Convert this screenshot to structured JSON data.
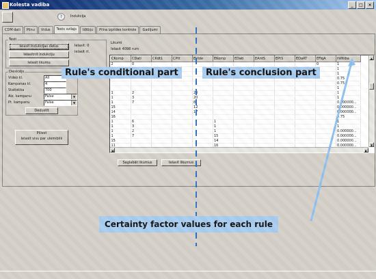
{
  "window": {
    "title": "Kolesta vadiba"
  },
  "toolbar": {
    "icon_glyph": "?",
    "label": "Indukcija"
  },
  "tabs": [
    {
      "label": "CDM dati"
    },
    {
      "label": "Pilnu"
    },
    {
      "label": "Vidus"
    },
    {
      "label": "Tests svilajs"
    },
    {
      "label": "Iđilbju"
    },
    {
      "label": "Pilna izpildes kontrole"
    },
    {
      "label": "Gadijumi"
    }
  ],
  "left_panel": {
    "top_group_caption": "Testi",
    "btn_primary": "Ielasit Indukcijas datus",
    "btn_second": "Ielasitnit indukciju",
    "btn_third": "Ielasit likumu",
    "side_labels": [
      "Ielasit: 0",
      "Ielasit rt."
    ],
    "settings_caption": "Dieslcējs",
    "fields": [
      {
        "label": "Video kl.",
        "value": "All"
      },
      {
        "label": "Kampanas kl.",
        "value": "4"
      },
      {
        "label": "Statistika",
        "value": "700"
      },
      {
        "label": "Aiz. kampanu",
        "value": "False"
      },
      {
        "label": "Pt. kampanu",
        "value": "False"
      }
    ],
    "btn_deduce": "Dedustīt",
    "btn_apply": "Piliest",
    "btn_apply_sub": "Ielasit visu par ulemiblik"
  },
  "grid": {
    "caption": "Likumi",
    "count_label": "Ielasit 4098 rum",
    "columns": [
      "CKomp",
      "CDati",
      "CKdt1",
      "CPtt",
      "EVide",
      "EKomp",
      "EDati",
      "EAntS",
      "EPtS",
      "EDaRT",
      "EFiqA",
      "tWitiba"
    ],
    "rows": [
      [
        "2",
        "0",
        "",
        "",
        "",
        "",
        "",
        "",
        "",
        "",
        "0",
        "1"
      ],
      [
        "",
        "",
        "",
        "",
        "",
        "",
        "",
        "",
        "",
        "",
        "",
        "1"
      ],
      [
        "",
        "",
        "",
        "",
        "",
        "",
        "",
        "",
        "",
        "",
        "",
        "1"
      ],
      [
        "",
        "",
        "",
        "",
        "",
        "",
        "",
        "",
        "",
        "",
        "",
        "0.75"
      ],
      [
        "",
        "",
        "",
        "",
        "",
        "",
        "",
        "",
        "",
        "",
        "",
        "0.75"
      ],
      [
        "",
        "",
        "",
        "",
        "",
        "",
        "",
        "",
        "",
        "",
        "",
        "1"
      ],
      [
        "1",
        "2",
        "",
        "",
        "20",
        "",
        "",
        "",
        "",
        "",
        "",
        "1"
      ],
      [
        "1",
        "3",
        "",
        "",
        "20",
        "",
        "",
        "",
        "",
        "",
        "",
        "1"
      ],
      [
        "1",
        "7",
        "",
        "",
        "8",
        "",
        "",
        "",
        "",
        "",
        "",
        "0.000000..."
      ],
      [
        "15",
        "",
        "",
        "",
        "12",
        "",
        "",
        "",
        "",
        "",
        "",
        "0.000000..."
      ],
      [
        "14",
        "",
        "",
        "",
        "17",
        "",
        "",
        "",
        "",
        "",
        "",
        "0.000000..."
      ],
      [
        "16",
        "",
        "",
        "",
        "",
        "",
        "",
        "",
        "",
        "",
        "",
        "0.75"
      ],
      [
        "1",
        "6",
        "",
        "",
        "",
        "1",
        "",
        "",
        "",
        "",
        "",
        "1"
      ],
      [
        "1",
        "3",
        "",
        "",
        "",
        "1",
        "",
        "",
        "",
        "",
        "",
        "1"
      ],
      [
        "1",
        "2",
        "",
        "",
        "",
        "1",
        "",
        "",
        "",
        "",
        "",
        "0.000000..."
      ],
      [
        "1",
        "7",
        "",
        "",
        "",
        "15",
        "",
        "",
        "",
        "",
        "",
        "0.000000..."
      ],
      [
        "15",
        "",
        "",
        "",
        "",
        "14",
        "",
        "",
        "",
        "",
        "",
        "0.000000..."
      ],
      [
        "11",
        "",
        "",
        "",
        "",
        "16",
        "",
        "",
        "",
        "",
        "",
        "0.000000..."
      ]
    ],
    "btn_left": "Saglabāt likumus",
    "btn_right": "Ielasit likumus"
  },
  "annotations": {
    "conditional": "Rule's conditional part",
    "conclusion": "Rule's conclusion part",
    "certainty": "Certainty factor values for each rule"
  },
  "colors": {
    "callout_fill": "#a8ccef",
    "arrow": "#8ec0ee",
    "divider": "#2d6fbf"
  }
}
